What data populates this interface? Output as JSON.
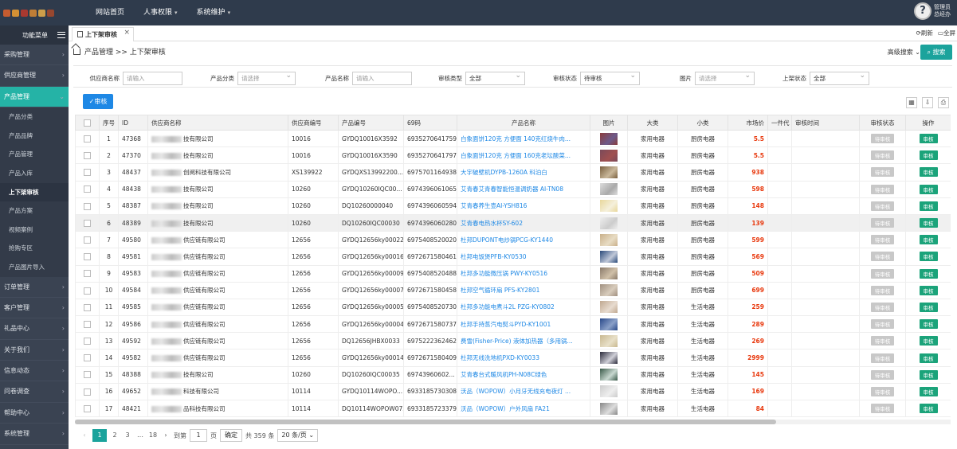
{
  "topbar": {
    "nav": [
      {
        "label": "网站首页",
        "has_arrow": false
      },
      {
        "label": "人事权限",
        "has_arrow": true
      },
      {
        "label": "系统维护",
        "has_arrow": true
      }
    ],
    "user_role": "管理员",
    "user_name": "总经办"
  },
  "sidebar": {
    "title": "功能菜单",
    "items": [
      {
        "label": "采购管理"
      },
      {
        "label": "供应商管理"
      },
      {
        "label": "产品管理",
        "open": true
      },
      {
        "label": "订单管理"
      },
      {
        "label": "客户管理"
      },
      {
        "label": "礼品中心"
      },
      {
        "label": "关于我们"
      },
      {
        "label": "信息动态"
      },
      {
        "label": "问卷调查"
      },
      {
        "label": "帮助中心"
      },
      {
        "label": "系统管理"
      }
    ],
    "sub_items": [
      "产品分类",
      "产品品牌",
      "产品管理",
      "产品入库",
      "上下架审核",
      "产品方案",
      "视频案例",
      "抢购专区",
      "产品图片导入"
    ]
  },
  "tabs": {
    "active": "上下架审核",
    "refresh": "刷新",
    "fullscreen": "全屏"
  },
  "breadcrumb": "产品管理 >> 上下架审核",
  "toolbar": {
    "advanced_search": "高级搜索",
    "search_button": "搜索",
    "audit_button": "审核"
  },
  "filters": {
    "supplier_name": {
      "label": "供应商名称",
      "placeholder": "请输入"
    },
    "category": {
      "label": "产品分类",
      "placeholder": "请选择"
    },
    "product_name": {
      "label": "产品名称",
      "placeholder": "请输入"
    },
    "audit_type": {
      "label": "审核类型",
      "value": "全部"
    },
    "audit_status": {
      "label": "审核状态",
      "value": "待审核"
    },
    "image": {
      "label": "图片",
      "placeholder": "请选择"
    },
    "shelf_status": {
      "label": "上架状态",
      "value": "全部"
    }
  },
  "table": {
    "headers": [
      "序号",
      "ID",
      "供应商名称",
      "供应商编号",
      "产品编号",
      "69码",
      "产品名称",
      "图片",
      "大类",
      "小类",
      "市场价",
      "一件代",
      "审核时间",
      "审核状态",
      "操作"
    ],
    "status_label": "待审核",
    "op_label": "审核",
    "rows": [
      {
        "no": "1",
        "id": "47368",
        "supplier": "技有限公司",
        "supplier_no": "10016",
        "product_no": "GYDQ10016X3592",
        "code69": "6935270641759",
        "name": "白象面饼120克 方便面 140克红烧牛肉...",
        "category": "家用电器",
        "subcategory": "厨房电器",
        "price": "5.5"
      },
      {
        "no": "2",
        "id": "47370",
        "supplier": "技有限公司",
        "supplier_no": "10016",
        "product_no": "GYDQ10016X3590",
        "code69": "6935270641797",
        "name": "白象面饼120克 方便面 160克老坛酸菜...",
        "category": "家用电器",
        "subcategory": "厨房电器",
        "price": "5.5"
      },
      {
        "no": "3",
        "id": "48437",
        "supplier": "创阅科技有限公司",
        "supplier_no": "XS139922",
        "product_no": "GYDQXS13992200...",
        "code69": "6975701164938",
        "name": "大宇破壁机DYPB-1260A 科泊白",
        "category": "家用电器",
        "subcategory": "厨房电器",
        "price": "938"
      },
      {
        "no": "4",
        "id": "48438",
        "supplier": "技有限公司",
        "supplier_no": "10260",
        "product_no": "GYDQ10260IQC00...",
        "code69": "6974396061065",
        "name": "艾青春艾青春智能恒温调奶器 AI-TN08",
        "category": "家用电器",
        "subcategory": "厨房电器",
        "price": "598"
      },
      {
        "no": "5",
        "id": "48387",
        "supplier": "技有限公司",
        "supplier_no": "10260",
        "product_no": "DQ10260000040",
        "code69": "6974396060594",
        "name": "艾青春养生壶AI-YSH816",
        "category": "家用电器",
        "subcategory": "厨房电器",
        "price": "148"
      },
      {
        "no": "6",
        "id": "48389",
        "supplier": "技有限公司",
        "supplier_no": "10260",
        "product_no": "DQ10260IQC00030",
        "code69": "6974396060280",
        "name": "艾青春电热水杯SY-602",
        "category": "家用电器",
        "subcategory": "厨房电器",
        "price": "139",
        "highlight": true
      },
      {
        "no": "7",
        "id": "49580",
        "supplier": "供应链有限公司",
        "supplier_no": "12656",
        "product_no": "GYDQ12656ky00022",
        "code69": "6975408520020",
        "name": "杜邦DUPONT电炒锅PCG-KY1440",
        "category": "家用电器",
        "subcategory": "厨房电器",
        "price": "599"
      },
      {
        "no": "8",
        "id": "49581",
        "supplier": "供应链有限公司",
        "supplier_no": "12656",
        "product_no": "GYDQ12656ky00016",
        "code69": "6972671580461",
        "name": "杜邦电饭煲PFB-KY0530",
        "category": "家用电器",
        "subcategory": "厨房电器",
        "price": "569"
      },
      {
        "no": "9",
        "id": "49583",
        "supplier": "供应链有限公司",
        "supplier_no": "12656",
        "product_no": "GYDQ12656ky00009",
        "code69": "6975408520488",
        "name": "杜邦多功能微压锅 PWY-KY0516",
        "category": "家用电器",
        "subcategory": "厨房电器",
        "price": "509"
      },
      {
        "no": "10",
        "id": "49584",
        "supplier": "供应链有限公司",
        "supplier_no": "12656",
        "product_no": "GYDQ12656ky00007",
        "code69": "6972671580458",
        "name": "杜邦空气循环扇 PFS-KY2801",
        "category": "家用电器",
        "subcategory": "厨房电器",
        "price": "699"
      },
      {
        "no": "11",
        "id": "49585",
        "supplier": "供应链有限公司",
        "supplier_no": "12656",
        "product_no": "GYDQ12656ky00005",
        "code69": "6975408520730",
        "name": "杜邦多功能电煮斗2L PZG-KY0802",
        "category": "家用电器",
        "subcategory": "生活电器",
        "price": "259"
      },
      {
        "no": "12",
        "id": "49586",
        "supplier": "供应链有限公司",
        "supplier_no": "12656",
        "product_no": "GYDQ12656ky00004",
        "code69": "6972671580737",
        "name": "杜邦手持蒸汽电熨斗PYD-KY1001",
        "category": "家用电器",
        "subcategory": "生活电器",
        "price": "289"
      },
      {
        "no": "13",
        "id": "49592",
        "supplier": "供应链有限公司",
        "supplier_no": "12656",
        "product_no": "DQ12656JHBX0033",
        "code69": "6975222362462",
        "name": "费雪(Fisher-Price) 液体加热器（多用锅...",
        "category": "家用电器",
        "subcategory": "生活电器",
        "price": "269"
      },
      {
        "no": "14",
        "id": "49582",
        "supplier": "供应链有限公司",
        "supplier_no": "12656",
        "product_no": "GYDQ12656ky00014",
        "code69": "6972671580409",
        "name": "杜邦无线洗地机PXD-KY0033",
        "category": "家用电器",
        "subcategory": "生活电器",
        "price": "2999"
      },
      {
        "no": "15",
        "id": "48388",
        "supplier": "技有限公司",
        "supplier_no": "10260",
        "product_no": "DQ10260IQC00035",
        "code69": "69743960602...",
        "name": "艾青春台式暖风机PH-N08C绿色",
        "category": "家用电器",
        "subcategory": "生活电器",
        "price": "145"
      },
      {
        "no": "16",
        "id": "49652",
        "supplier": "科技有限公司",
        "supplier_no": "10114",
        "product_no": "GYDQ10114WOPO...",
        "code69": "6933185730308",
        "name": "沃品（WOPOW）小月牙无线充电夜灯 ...",
        "category": "家用电器",
        "subcategory": "生活电器",
        "price": "169"
      },
      {
        "no": "17",
        "id": "48421",
        "supplier": "品科技有限公司",
        "supplier_no": "10114",
        "product_no": "DQ10114WOPOW075",
        "code69": "6933185723379",
        "name": "沃品（WOPOW）户外风扇 FA21",
        "category": "家用电器",
        "subcategory": "生活电器",
        "price": "84"
      }
    ]
  },
  "pagination": {
    "pages": [
      "1",
      "2",
      "3",
      "…",
      "18"
    ],
    "goto_label": "到第",
    "goto_value": "1",
    "page_unit": "页",
    "confirm": "确定",
    "total": "共 359 条",
    "page_size": "20 条/页"
  },
  "colors": {
    "accent": "#1ba39c",
    "sidebar_active": "#25b3a6",
    "price": "#e8380d",
    "link": "#1e88e5",
    "topbar": "#2f3b4c"
  }
}
